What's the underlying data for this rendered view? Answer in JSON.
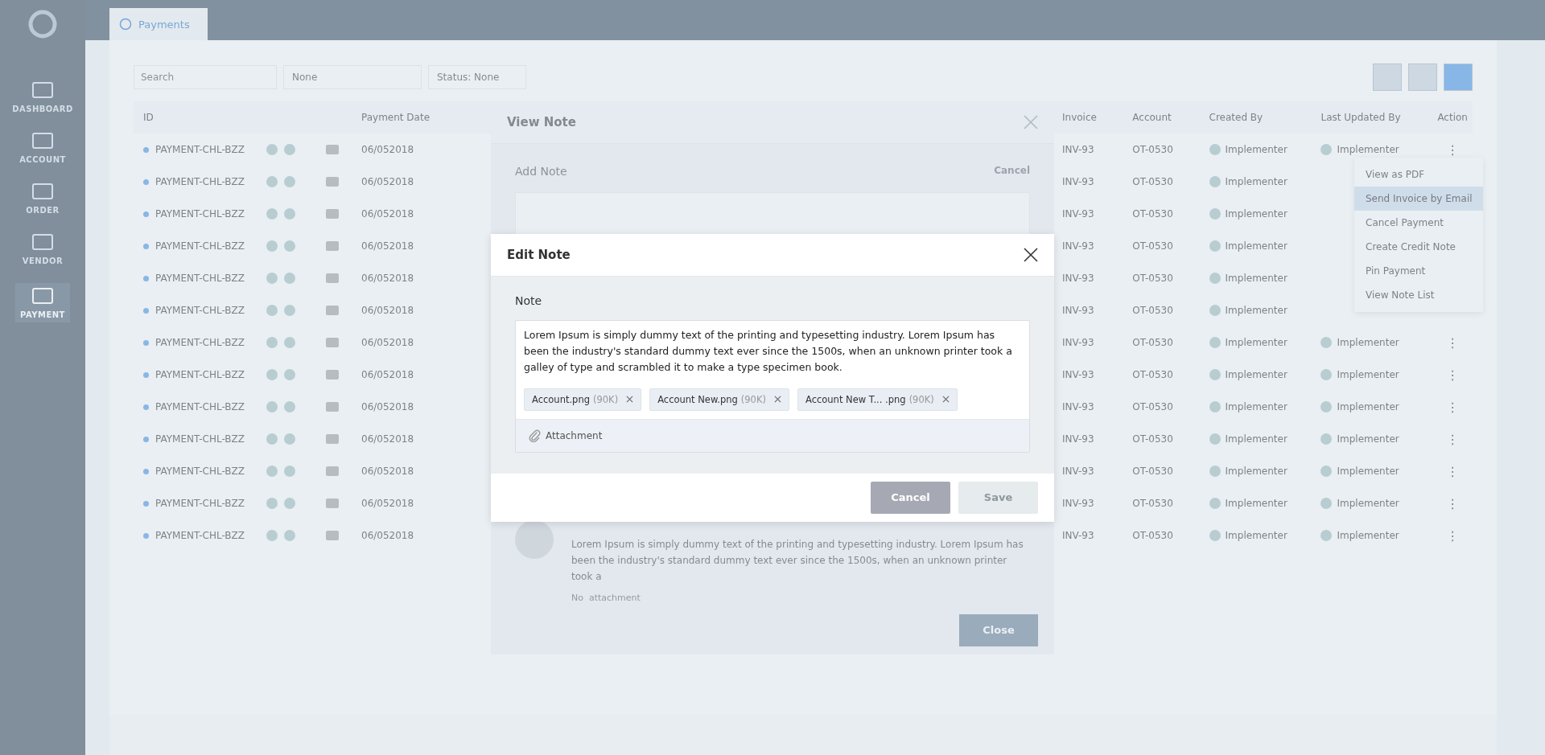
{
  "sidebar": {
    "items": [
      {
        "label": "DASHBOARD",
        "selected": false
      },
      {
        "label": "ACCOUNT",
        "selected": false
      },
      {
        "label": "ORDER",
        "selected": false
      },
      {
        "label": "VENDOR",
        "selected": false
      },
      {
        "label": "PAYMENT",
        "selected": true
      }
    ]
  },
  "tabs": [
    {
      "label": "Payments",
      "selected": true
    }
  ],
  "filters": {
    "search": {
      "placeholder": "Search"
    },
    "type": "None",
    "status": "Status: None"
  },
  "table": {
    "columns_left": [
      "ID",
      "Payment Date"
    ],
    "columns_right": [
      "Invoice",
      "Account",
      "Created By",
      "Last Updated By",
      "Action"
    ],
    "rows": [
      {
        "id": "PAYMENT-CHL-BZZ",
        "date": "06/052018",
        "invoice": "INV-93",
        "account": "OT-0530",
        "created_by": "Implementer",
        "updated_by": "Implementer",
        "action": "⋮"
      },
      {
        "id": "PAYMENT-CHL-BZZ",
        "date": "06/052018",
        "invoice": "INV-93",
        "account": "OT-0530",
        "created_by": "Implementer"
      },
      {
        "id": "PAYMENT-CHL-BZZ",
        "date": "06/052018",
        "invoice": "INV-93",
        "account": "OT-0530",
        "created_by": "Implementer"
      },
      {
        "id": "PAYMENT-CHL-BZZ",
        "date": "06/052018",
        "invoice": "INV-93",
        "account": "OT-0530",
        "created_by": "Implementer"
      },
      {
        "id": "PAYMENT-CHL-BZZ",
        "date": "06/052018",
        "invoice": "INV-93",
        "account": "OT-0530",
        "created_by": "Implementer"
      },
      {
        "id": "PAYMENT-CHL-BZZ",
        "date": "06/052018",
        "invoice": "INV-93",
        "account": "OT-0530",
        "created_by": "Implementer"
      },
      {
        "id": "PAYMENT-CHL-BZZ",
        "date": "06/052018",
        "invoice": "INV-93",
        "account": "OT-0530",
        "created_by": "Implementer",
        "updated_by": "Implementer",
        "action": "⋮"
      },
      {
        "id": "PAYMENT-CHL-BZZ",
        "date": "06/052018",
        "invoice": "INV-93",
        "account": "OT-0530",
        "created_by": "Implementer",
        "updated_by": "Implementer",
        "action": "⋮"
      },
      {
        "id": "PAYMENT-CHL-BZZ",
        "date": "06/052018",
        "invoice": "INV-93",
        "account": "OT-0530",
        "created_by": "Implementer",
        "updated_by": "Implementer",
        "action": "⋮"
      },
      {
        "id": "PAYMENT-CHL-BZZ",
        "date": "06/052018",
        "invoice": "INV-93",
        "account": "OT-0530",
        "created_by": "Implementer",
        "updated_by": "Implementer",
        "action": "⋮"
      },
      {
        "id": "PAYMENT-CHL-BZZ",
        "date": "06/052018",
        "invoice": "INV-93",
        "account": "OT-0530",
        "created_by": "Implementer",
        "updated_by": "Implementer",
        "action": "⋮"
      },
      {
        "id": "PAYMENT-CHL-BZZ",
        "date": "06/052018",
        "invoice": "INV-93",
        "account": "OT-0530",
        "created_by": "Implementer",
        "updated_by": "Implementer",
        "action": "⋮"
      },
      {
        "id": "PAYMENT-CHL-BZZ",
        "date": "06/052018",
        "invoice": "INV-93",
        "account": "OT-0530",
        "created_by": "Implementer",
        "updated_by": "Implementer",
        "action": "⋮"
      }
    ]
  },
  "row_menu": {
    "items": [
      {
        "label": "View as PDF",
        "selected": false
      },
      {
        "label": "Send Invoice by Email",
        "selected": true
      },
      {
        "label": "Cancel Payment",
        "selected": false
      },
      {
        "label": "Create Credit Note",
        "selected": false
      },
      {
        "label": "Pin Payment",
        "selected": false
      },
      {
        "label": "View Note List",
        "selected": false
      }
    ]
  },
  "view_note_dialog": {
    "title": "View Note",
    "add_note_label": "Add Note",
    "cancel_link": "Cancel",
    "note_text": "Lorem Ipsum is simply dummy text of the printing and typesetting industry. Lorem Ipsum has been the industry's standard dummy text ever since the 1500s, when an unknown printer took a",
    "attachment_status": "No  attachment",
    "close_button": "Close"
  },
  "edit_note_dialog": {
    "title": "Edit Note",
    "field_label": "Note",
    "note_text": "Lorem Ipsum is simply dummy text of the printing and typesetting industry. Lorem Ipsum has been the industry's standard dummy text ever since the 1500s, when an unknown printer took a galley of type and scrambled it to make a type specimen book.",
    "attachments": [
      {
        "name": "Account.png",
        "size": "(90K)"
      },
      {
        "name": "Account New.png",
        "size": "(90K)"
      },
      {
        "name": "Account New T... .png",
        "size": "(90K)"
      }
    ],
    "attach_button": "Attachment",
    "buttons": [
      {
        "label": "Cancel",
        "kind": "secondary",
        "disabled": false
      },
      {
        "label": "Save",
        "kind": "primary",
        "disabled": true
      }
    ]
  }
}
